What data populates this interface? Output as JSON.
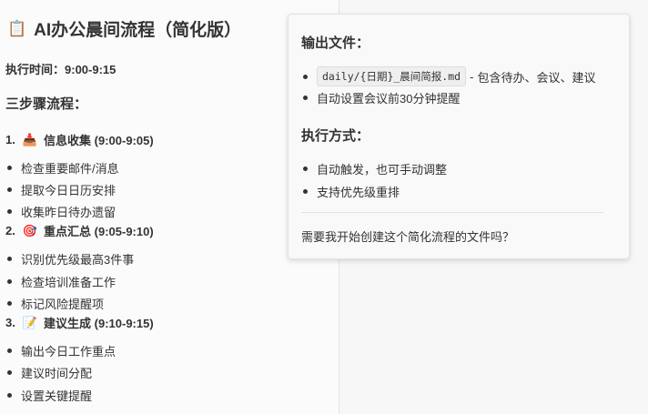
{
  "doc": {
    "title_icon": "📋",
    "title": "AI办公晨间流程（简化版）",
    "exec_label": "执行时间：",
    "exec_value": "9:00-9:15",
    "steps_heading": "三步骤流程：",
    "steps": [
      {
        "num": "1.",
        "emoji": "📥",
        "label": "信息收集 (9:00-9:05)",
        "items": [
          "检查重要邮件/消息",
          "提取今日日历安排",
          "收集昨日待办遗留"
        ]
      },
      {
        "num": "2.",
        "emoji": "🎯",
        "label": "重点汇总 (9:05-9:10)",
        "items": [
          "识别优先级最高3件事",
          "检查培训准备工作",
          "标记风险提醒项"
        ]
      },
      {
        "num": "3.",
        "emoji": "📝",
        "label": "建议生成 (9:10-9:15)",
        "items": [
          "输出今日工作重点",
          "建议时间分配",
          "设置关键提醒"
        ]
      }
    ]
  },
  "popup": {
    "output_heading": "输出文件：",
    "output_file": "daily/{日期}_晨间简报.md",
    "output_sep": "-",
    "output_desc": "包含待办、会议、建议",
    "output_item2": "自动设置会议前30分钟提醒",
    "method_heading": "执行方式：",
    "method_items": [
      "自动触发，也可手动调整",
      "支持优先级重排"
    ],
    "question": "需要我开始创建这个简化流程的文件吗？"
  }
}
